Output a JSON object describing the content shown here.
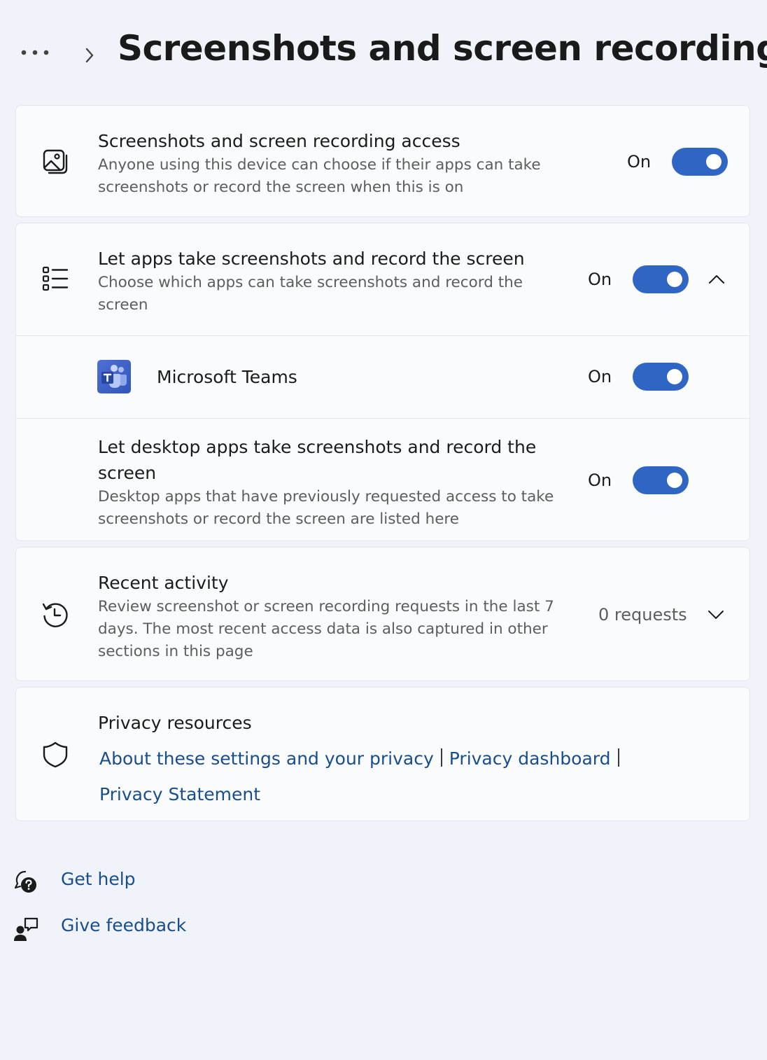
{
  "header": {
    "more_icon": "more-horizontal-icon",
    "breadcrumb_separator_icon": "chevron-right-icon",
    "title": "Screenshots and screen recording"
  },
  "access_card": {
    "icon": "image-icon",
    "title": "Screenshots and screen recording access",
    "description": "Anyone using this device can choose if their apps can take screenshots or record the screen when this is on",
    "state_label": "On",
    "toggle_on": true
  },
  "apps_card": {
    "header": {
      "icon": "list-icon",
      "title": "Let apps take screenshots and record the screen",
      "description": "Choose which apps can take screenshots and record the screen",
      "state_label": "On",
      "toggle_on": true,
      "expand_icon": "chevron-up-icon"
    },
    "teams": {
      "icon": "microsoft-teams-icon",
      "name": "Microsoft Teams",
      "state_label": "On",
      "toggle_on": true
    },
    "desktop": {
      "title": "Let desktop apps take screenshots and record the screen",
      "description": "Desktop apps that have previously requested access to take screenshots or record the screen are listed here",
      "state_label": "On",
      "toggle_on": true
    }
  },
  "activity_card": {
    "icon": "history-icon",
    "title": "Recent activity",
    "description": "Review screenshot or screen recording requests in the last 7 days. The most recent access data is also captured in other sections in this page",
    "count_label": "0 requests",
    "expand_icon": "chevron-down-icon"
  },
  "privacy_card": {
    "icon": "shield-icon",
    "title": "Privacy resources",
    "links": [
      "About these settings and your privacy",
      "Privacy dashboard",
      "Privacy Statement"
    ]
  },
  "footer": {
    "get_help": {
      "icon": "help-chat-icon",
      "label": "Get help"
    },
    "give_feedback": {
      "icon": "feedback-person-icon",
      "label": "Give feedback"
    }
  },
  "colors": {
    "accent": "#2f66c4",
    "link": "#1a4d8c",
    "page_background": "#f0f3f9",
    "card_background": "#f9fbfd"
  }
}
